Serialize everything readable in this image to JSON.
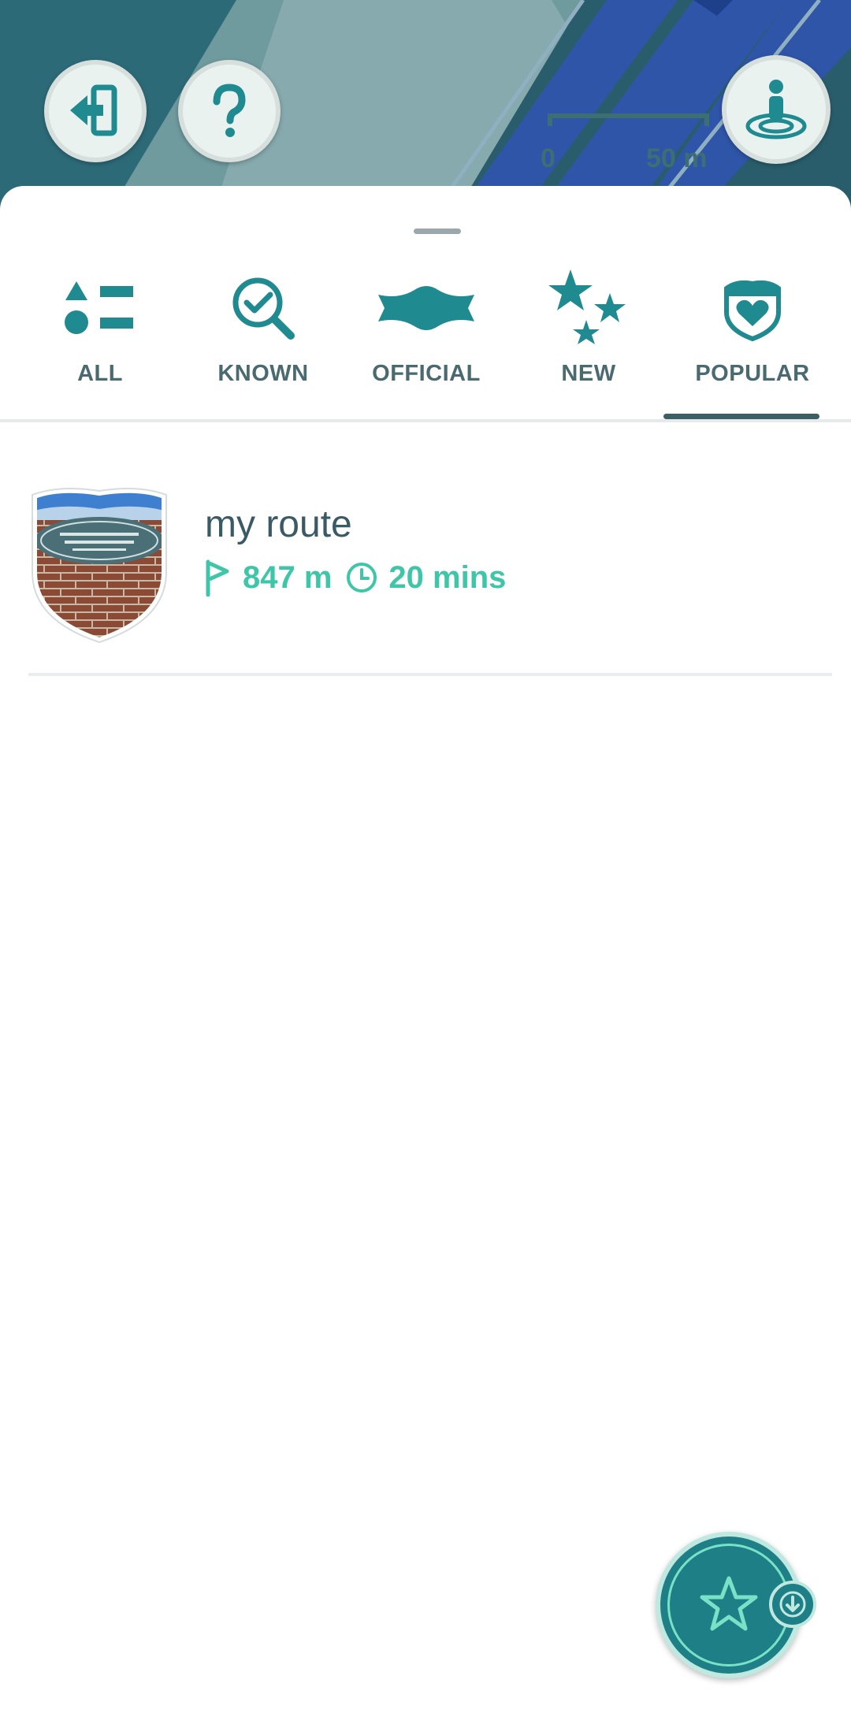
{
  "map": {
    "scale_start": "0",
    "scale_end": "50 m",
    "exit_icon": "exit-icon",
    "help_icon": "question-icon",
    "avatar_icon": "avatar-location-icon"
  },
  "tabs": [
    {
      "label": "ALL",
      "icon": "shapes-icon"
    },
    {
      "label": "KNOWN",
      "icon": "magnifier-check-icon"
    },
    {
      "label": "OFFICIAL",
      "icon": "banner-icon"
    },
    {
      "label": "NEW",
      "icon": "stars-icon"
    },
    {
      "label": "POPULAR",
      "icon": "heart-shield-icon"
    }
  ],
  "selected_tab": "POPULAR",
  "routes": [
    {
      "name": "my route",
      "distance": "847 m",
      "duration": "20 mins"
    }
  ],
  "colors": {
    "accent": "#1f8a8f",
    "meta_green": "#3fc6a8",
    "tab_label": "#4a6a70"
  },
  "fab": {
    "icon": "star-download-icon"
  }
}
